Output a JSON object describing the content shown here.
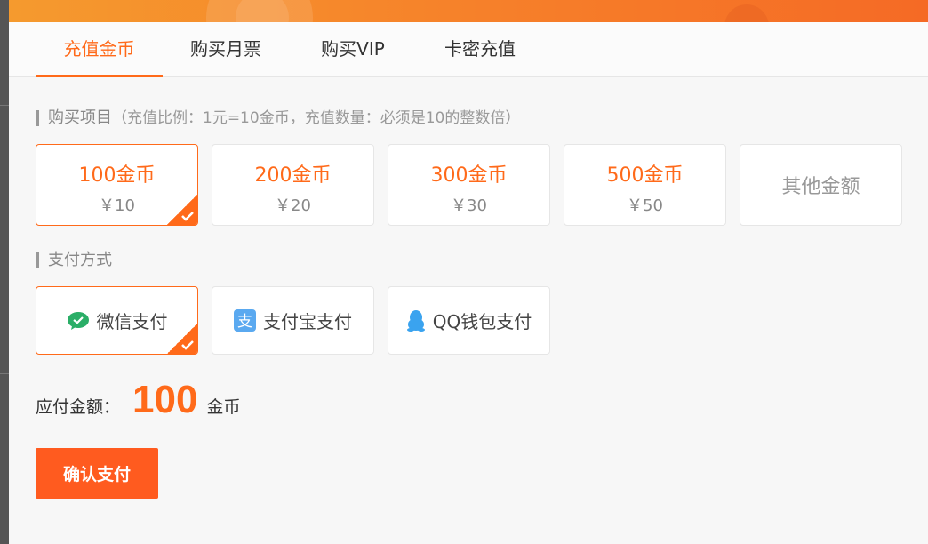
{
  "tabs": [
    {
      "label": "充值金币",
      "active": true
    },
    {
      "label": "购买月票",
      "active": false
    },
    {
      "label": "购买VIP",
      "active": false
    },
    {
      "label": "卡密充值",
      "active": false
    }
  ],
  "purchase": {
    "title": "购买项目",
    "note": "（充值比例：1元=10金币，充值数量：必须是10的整数倍）",
    "options": [
      {
        "coins": "100金币",
        "price": "￥10",
        "selected": true
      },
      {
        "coins": "200金币",
        "price": "￥20",
        "selected": false
      },
      {
        "coins": "300金币",
        "price": "￥30",
        "selected": false
      },
      {
        "coins": "500金币",
        "price": "￥50",
        "selected": false
      }
    ],
    "other_label": "其他金额"
  },
  "payment": {
    "title": "支付方式",
    "methods": [
      {
        "label": "微信支付",
        "icon": "wechat-icon",
        "selected": true
      },
      {
        "label": "支付宝支付",
        "icon": "alipay-icon",
        "selected": false
      },
      {
        "label": "QQ钱包支付",
        "icon": "qq-icon",
        "selected": false
      }
    ]
  },
  "amount": {
    "label": "应付金额：",
    "value": "100",
    "unit": "金币"
  },
  "confirm_label": "确认支付",
  "colors": {
    "accent": "#ff6a1a",
    "button": "#ff5b1f",
    "wechat": "#2aae67",
    "alipay": "#1e9fe8",
    "qq": "#1e9fe8"
  }
}
